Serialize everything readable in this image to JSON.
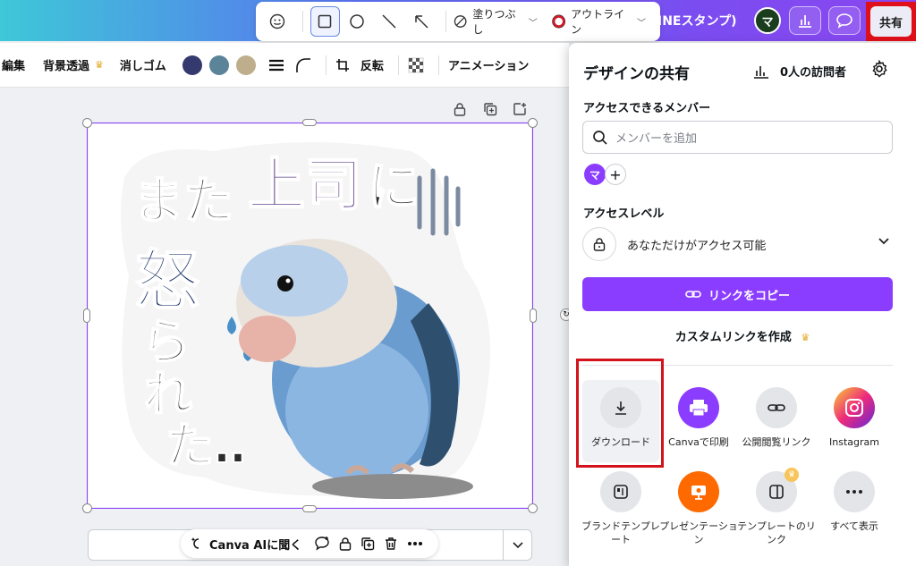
{
  "topbar": {
    "title": "INEスタンプ)",
    "avatar_letter": "マ",
    "share_label": "共有"
  },
  "drawing_toolbar": {
    "fill_label": "塗りつぶし",
    "outline_label": "アウトライン"
  },
  "edit_toolbar": {
    "edit_label": "編集",
    "remove_bg_label": "背景透過",
    "eraser_label": "消しゴム",
    "colors": [
      "#353a6e",
      "#5b8499",
      "#bfae8b"
    ],
    "flip_label": "反転",
    "animation_label": "アニメーション"
  },
  "bottom_bar": {
    "ai_label": "Canva AIに聞く"
  },
  "share_panel": {
    "title": "デザインの共有",
    "visitors": "0人の訪問者",
    "members_heading": "アクセスできるメンバー",
    "member_placeholder": "メンバーを追加",
    "member_avatar": "マ",
    "access_heading": "アクセスレベル",
    "access_value": "あなただけがアクセス可能",
    "copy_link": "リンクをコピー",
    "custom_link": "カスタムリンクを作成",
    "options": [
      {
        "label": "ダウンロード"
      },
      {
        "label": "Canvaで印刷"
      },
      {
        "label": "公開閲覧リンク"
      },
      {
        "label": "Instagram"
      },
      {
        "label": "ブランドテンプレート"
      },
      {
        "label": "プレゼンテーション"
      },
      {
        "label": "テンプレートのリンク"
      },
      {
        "label": "すべて表示"
      }
    ]
  }
}
